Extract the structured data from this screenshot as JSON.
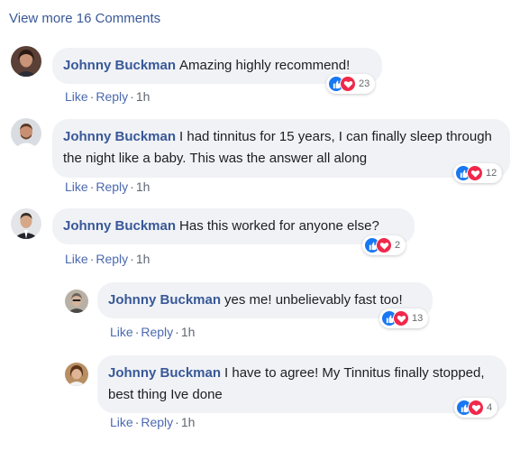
{
  "view_more": "View more 16 Comments",
  "comments": [
    {
      "author": "Johnny Buckman",
      "text": "Amazing highly recommend!",
      "like": "Like",
      "reply": "Reply",
      "time": "1h",
      "reactions": "23"
    },
    {
      "author": "Johnny Buckman",
      "text": "I had tinnitus for 15 years, I can finally sleep through the night like a baby. This was the answer all along",
      "like": "Like",
      "reply": "Reply",
      "time": "1h",
      "reactions": "12"
    },
    {
      "author": "Johnny Buckman",
      "text": "Has this worked for anyone else?",
      "like": "Like",
      "reply": "Reply",
      "time": "1h",
      "reactions": "2"
    },
    {
      "author": "Johnny Buckman",
      "text": "yes me! unbelievably fast too!",
      "like": "Like",
      "reply": "Reply",
      "time": "1h",
      "reactions": "13"
    },
    {
      "author": "Johnny Buckman",
      "text": "I have to agree! My Tinnitus finally stopped, best thing Ive done",
      "like": "Like",
      "reply": "Reply",
      "time": "1h",
      "reactions": "4"
    }
  ],
  "colors": {
    "link": "#385898",
    "bubble": "#f0f2f5",
    "like_blue": "#1877f2",
    "love_red": "#f0284a"
  },
  "icons": [
    "thumbs-up-icon",
    "heart-icon"
  ]
}
